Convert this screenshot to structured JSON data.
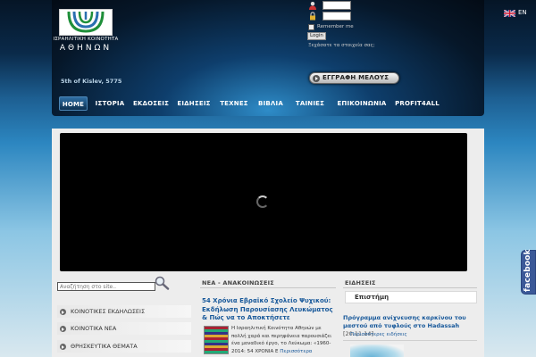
{
  "header": {
    "logo_line1": "ΙΣΡΑΗΛΙΤΙΚΗ ΚΟΙΝΟΤΗΤΑ",
    "logo_line2": "ΑΘΗΝΩΝ",
    "date_text": "5th of Kislev, 5775"
  },
  "login": {
    "remember_label": "Remember me",
    "login_button": "Login",
    "forgot_text": "Ξεχάσατε τα στοιχεία σας;"
  },
  "register": {
    "label": "ΕΓΓΡΑΦΗ ΜΕΛΟΥΣ"
  },
  "language": {
    "label": "EN"
  },
  "nav": {
    "items": [
      "HOME",
      "ΙΣΤΟΡΙΑ",
      "ΕΚΔΟΣΕΙΣ",
      "ΕΙΔΗΣΕΙΣ",
      "ΤΕΧΝΕΣ",
      "ΒΙΒΛΙΑ",
      "ΤΑΙΝΙΕΣ",
      "ΕΠΙΚΟΙΝΩΝΙΑ",
      "PROFIT4ALL"
    ]
  },
  "search": {
    "placeholder": "Αναζήτηση στο site.."
  },
  "sidebar": {
    "items": [
      "ΚΟΙΝΟΤΙΚΕΣ ΕΚΔΗΛΩΣΕΙΣ",
      "ΚΟΙΝΟΤΙΚΑ ΝΕΑ",
      "ΘΡΗΣΚΕΥΤΙΚΑ ΘΕΜΑΤΑ"
    ]
  },
  "news": {
    "heading": "ΝΕΑ - ΑΝΑΚΟΙΝΩΣΕΙΣ",
    "title": "54 Χρόνια Εβραϊκό Σχολείο Ψυχικού: Εκδήλωση Παρουσίασης Λευκώματος & Πώς να το Αποκτήσετε",
    "body": "Η Ισραηλιτική Κοινότητα Αθηνών με πολλή χαρά και περηφάνεια παρουσιάζει ένα μοναδικό έργο, το Λεύκωμα: «1960-2014: 54 ΧΡΟΝΙΑ Ε",
    "more": "Περισσότερα"
  },
  "events": {
    "heading": "ΕΙΔΗΣΕΙΣ",
    "subheading": "Επιστήμη",
    "title": "Πρόγραμμα ανίχνευσης καρκίνου του μαστού από τυφλούς στο Hadassah",
    "date": "[20.11.14]",
    "more": "Περισσότερες ειδήσεις"
  },
  "facebook": {
    "label": "facebook"
  },
  "colors": {
    "link_blue": "#17589a",
    "facebook_blue": "#3b5998",
    "header_dark": "#061729"
  }
}
